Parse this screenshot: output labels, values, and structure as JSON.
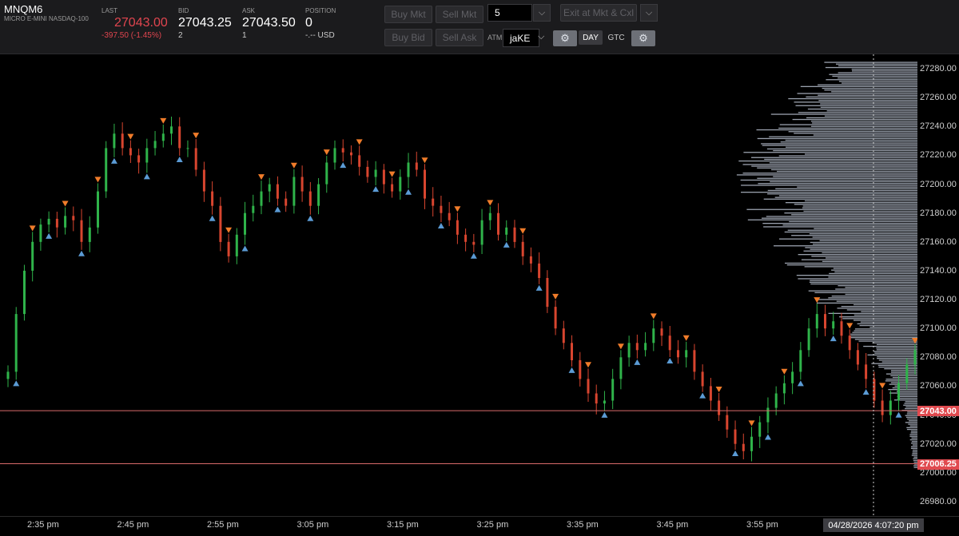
{
  "instrument": {
    "symbol": "MNQM6",
    "description": "MICRO E-MINI NASDAQ-100"
  },
  "quote": {
    "last_label": "LAST",
    "last_value": "27043.00",
    "last_change": "-397.50 (-1.45%)",
    "bid_label": "BID",
    "bid_value": "27043.25",
    "bid_size": "2",
    "ask_label": "ASK",
    "ask_value": "27043.50",
    "ask_size": "1",
    "position_label": "POSITION",
    "position_value": "0",
    "position_pnl": "-.-- USD"
  },
  "orders": {
    "buy_mkt": "Buy Mkt",
    "sell_mkt": "Sell Mkt",
    "buy_bid": "Buy Bid",
    "sell_ask": "Sell Ask",
    "quantity": "5",
    "exit_label": "Exit at Mkt & Cxl",
    "atm_label": "ATM",
    "atm_value": "jaKE",
    "tif_day": "DAY",
    "tif_gtc": "GTC"
  },
  "colors": {
    "up": "#2fb34a",
    "down": "#d8452f",
    "buy_marker": "#5b9bd5",
    "sell_marker": "#f07c2a",
    "profile": "#9aa1ad",
    "last_line": "#d96a6a",
    "accent_red": "#e04a4f"
  },
  "chart_data": {
    "type": "candlestick",
    "x_ticks": [
      "2:35 pm",
      "2:45 pm",
      "2:55 pm",
      "3:05 pm",
      "3:15 pm",
      "3:25 pm",
      "3:35 pm",
      "3:45 pm",
      "3:55 pm"
    ],
    "y_ticks": [
      "27280.00",
      "27260.00",
      "27240.00",
      "27220.00",
      "27200.00",
      "27180.00",
      "27160.00",
      "27140.00",
      "27120.00",
      "27100.00",
      "27080.00",
      "27060.00",
      "27040.00",
      "27020.00",
      "27000.00",
      "26980.00"
    ],
    "ylim": [
      26970,
      27290
    ],
    "series_close": [
      27070,
      27110,
      27140,
      27160,
      27172,
      27176,
      27170,
      27178,
      27175,
      27160,
      27170,
      27195,
      27225,
      27235,
      27225,
      27220,
      27215,
      27225,
      27230,
      27235,
      27240,
      27225,
      27225,
      27210,
      27195,
      27185,
      27160,
      27150,
      27165,
      27180,
      27185,
      27195,
      27200,
      27190,
      27185,
      27205,
      27195,
      27185,
      27200,
      27215,
      27225,
      27222,
      27220,
      27212,
      27205,
      27210,
      27200,
      27195,
      27205,
      27215,
      27210,
      27190,
      27185,
      27180,
      27175,
      27165,
      27160,
      27158,
      27175,
      27180,
      27165,
      27170,
      27160,
      27150,
      27145,
      27135,
      27115,
      27100,
      27090,
      27078,
      27065,
      27055,
      27048,
      27050,
      27065,
      27080,
      27090,
      27085,
      27090,
      27100,
      27095,
      27085,
      27080,
      27085,
      27070,
      27060,
      27050,
      27040,
      27030,
      27020,
      27015,
      27025,
      27035,
      27045,
      27055,
      27062,
      27070,
      27085,
      27100,
      27110,
      27100,
      27105,
      27095,
      27085,
      27075,
      27065,
      27050,
      27040,
      27050,
      27062,
      27075,
      27085
    ],
    "profile_max_price": 27200,
    "last_price": "27043.00",
    "session_low": "27006.25",
    "cursor_time": "04/28/2026 4:07:20 pm"
  }
}
